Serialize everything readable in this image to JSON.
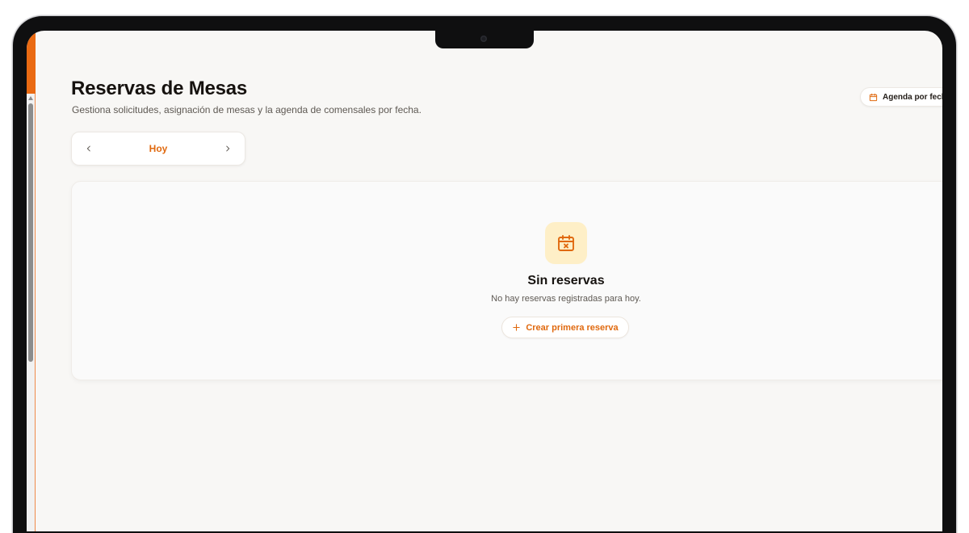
{
  "header": {
    "title": "Reservas de Mesas",
    "subtitle": "Gestiona solicitudes, asignación de mesas y la agenda de comensales por fecha.",
    "agenda_button": "Agenda por fech"
  },
  "date_nav": {
    "current": "Hoy",
    "prev_icon": "chevron-left-icon",
    "next_icon": "chevron-right-icon"
  },
  "empty_state": {
    "icon": "calendar-x-icon",
    "title": "Sin reservas",
    "message": "No hay reservas registradas para hoy.",
    "action_label": "Crear primera reserva",
    "action_icon": "plus-icon"
  },
  "colors": {
    "accent": "#ea6a12",
    "accent_text": "#e0690f",
    "icon_bg": "#feefc7",
    "background": "#f8f7f5"
  }
}
